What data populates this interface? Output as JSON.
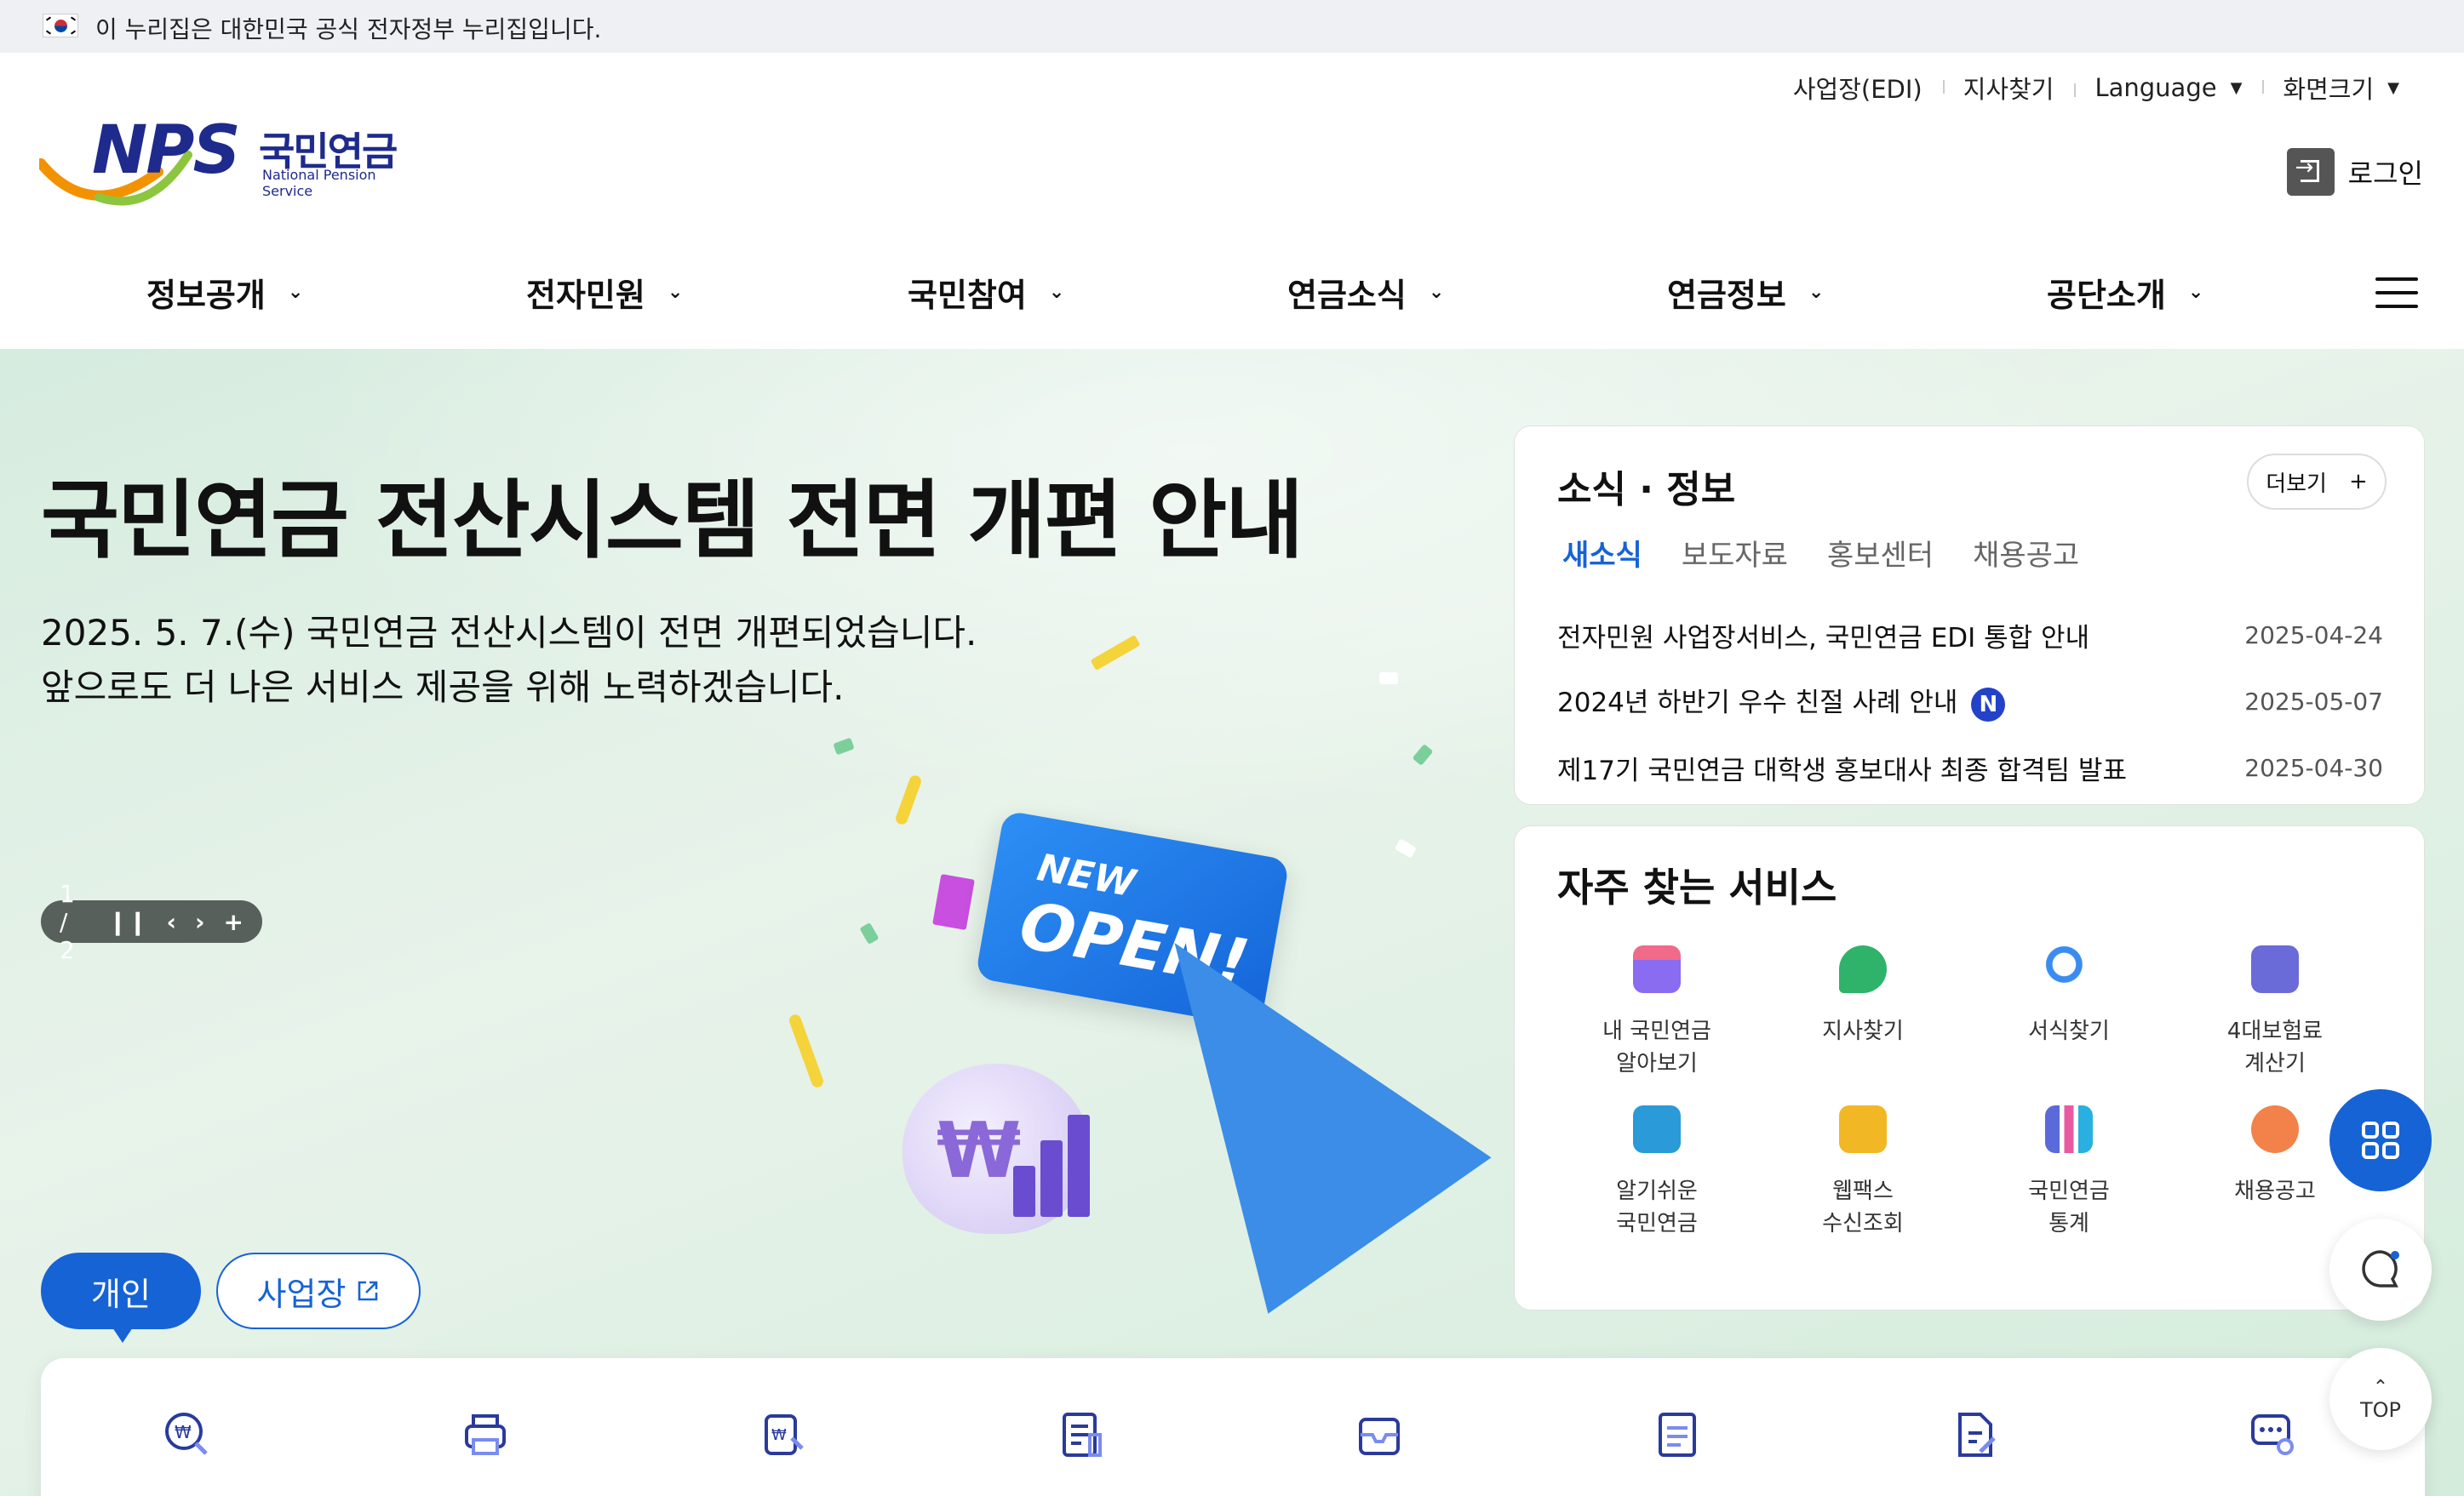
{
  "gov_banner": {
    "text": "이 누리집은 대한민국 공식 전자정부 누리집입니다."
  },
  "logo": {
    "brand": "NPS",
    "name_ko": "국민연금",
    "name_en": "National Pension Service"
  },
  "utility": {
    "links": [
      "사업장(EDI)",
      "지사찾기",
      "Language",
      "화면크기"
    ],
    "login_label": "로그인"
  },
  "gnb": {
    "menus": [
      "정보공개",
      "전자민원",
      "국민참여",
      "연금소식",
      "연금정보",
      "공단소개"
    ]
  },
  "hero": {
    "title": "국민연금 전산시스템 전면 개편 안내",
    "description": "2025. 5. 7.(수) 국민연금 전산시스템이 전면 개편되었습니다.\n앞으로도 더 나은 서비스 제공을 위해 노력하겠습니다.",
    "slide_counter": "1 / 2",
    "ticket_small": "NEW",
    "ticket_big": "OPEN!",
    "bag_symbol": "₩"
  },
  "audience_tabs": {
    "individual": "개인",
    "business": "사업장"
  },
  "news": {
    "title": "소식 · 정보",
    "more_label": "더보기",
    "tabs": [
      "새소식",
      "보도자료",
      "홍보센터",
      "채용공고"
    ],
    "active_tab": "새소식",
    "items": [
      {
        "title": "전자민원 사업장서비스, 국민연금 EDI 통합 안내",
        "date": "2025-04-24",
        "new": false
      },
      {
        "title": "2024년 하반기 우수 친절 사례 안내",
        "date": "2025-05-07",
        "new": true
      },
      {
        "title": "제17기 국민연금 대학생 홍보대사 최종 합격팀 발표",
        "date": "2025-04-30",
        "new": false
      }
    ],
    "new_badge": "N"
  },
  "services": {
    "title": "자주 찾는 서비스",
    "items": [
      {
        "label": "내 국민연금\n알아보기",
        "icon": "gift-icon",
        "color": "#8a6cf0"
      },
      {
        "label": "지사찾기",
        "icon": "map-pin-icon",
        "color": "#2fb36a"
      },
      {
        "label": "서식찾기",
        "icon": "magnifier-icon",
        "color": "#3a8cf0"
      },
      {
        "label": "4대보험료\n계산기",
        "icon": "calculator-icon",
        "color": "#6a6ad8"
      },
      {
        "label": "알기쉬운\n국민연금",
        "icon": "monitor-icon",
        "color": "#2a9ad8"
      },
      {
        "label": "웹팩스\n수신조회",
        "icon": "fax-icon",
        "color": "#f2b724"
      },
      {
        "label": "국민연금\n통계",
        "icon": "bar-chart-icon",
        "color": "#5a6ad8"
      },
      {
        "label": "채용공고",
        "icon": "speech-bubble-icon",
        "color": "#f2824a"
      }
    ]
  },
  "floating": {
    "top_label": "TOP"
  },
  "colors": {
    "primary": "#1663d6",
    "brand_navy": "#1e2a8c",
    "hero_bg": "#d6ecdf"
  }
}
